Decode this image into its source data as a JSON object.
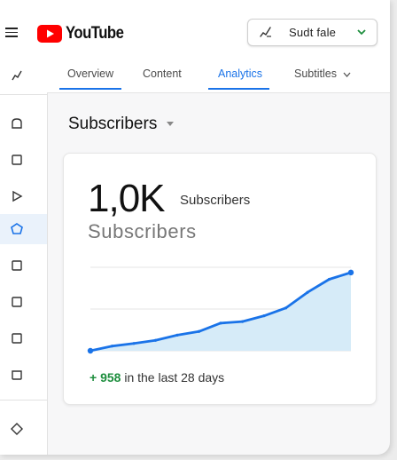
{
  "header": {
    "wordmark": "YouTube",
    "channel_select": {
      "label": "Sudt fale"
    }
  },
  "tabs": [
    {
      "label": "Overview"
    },
    {
      "label": "Content"
    },
    {
      "label": "Analytics"
    },
    {
      "label": "Subtitles"
    }
  ],
  "section": {
    "title": "Subscribers"
  },
  "card": {
    "big_value": "1,0K",
    "big_unit": "Subscribers",
    "metric_label": "Subscribers",
    "delta_sign": "+",
    "delta_value": "958",
    "delta_text": "in the last 28 days"
  },
  "colors": {
    "accent": "#1a73e8",
    "line": "#1a73e8",
    "area": "#d6ebf8",
    "positive": "#1e8e3e",
    "brand_red": "#ff0000"
  },
  "chart_data": {
    "type": "area",
    "x": [
      0,
      1,
      2,
      3,
      4,
      5,
      6,
      7,
      8,
      9,
      10,
      11,
      12
    ],
    "series": [
      {
        "values": [
          0,
          9,
          14,
          20,
          30,
          37,
          53,
          56,
          67,
          82,
          112,
          137,
          150
        ]
      }
    ],
    "ylim": [
      0,
      160
    ],
    "grid": true
  }
}
